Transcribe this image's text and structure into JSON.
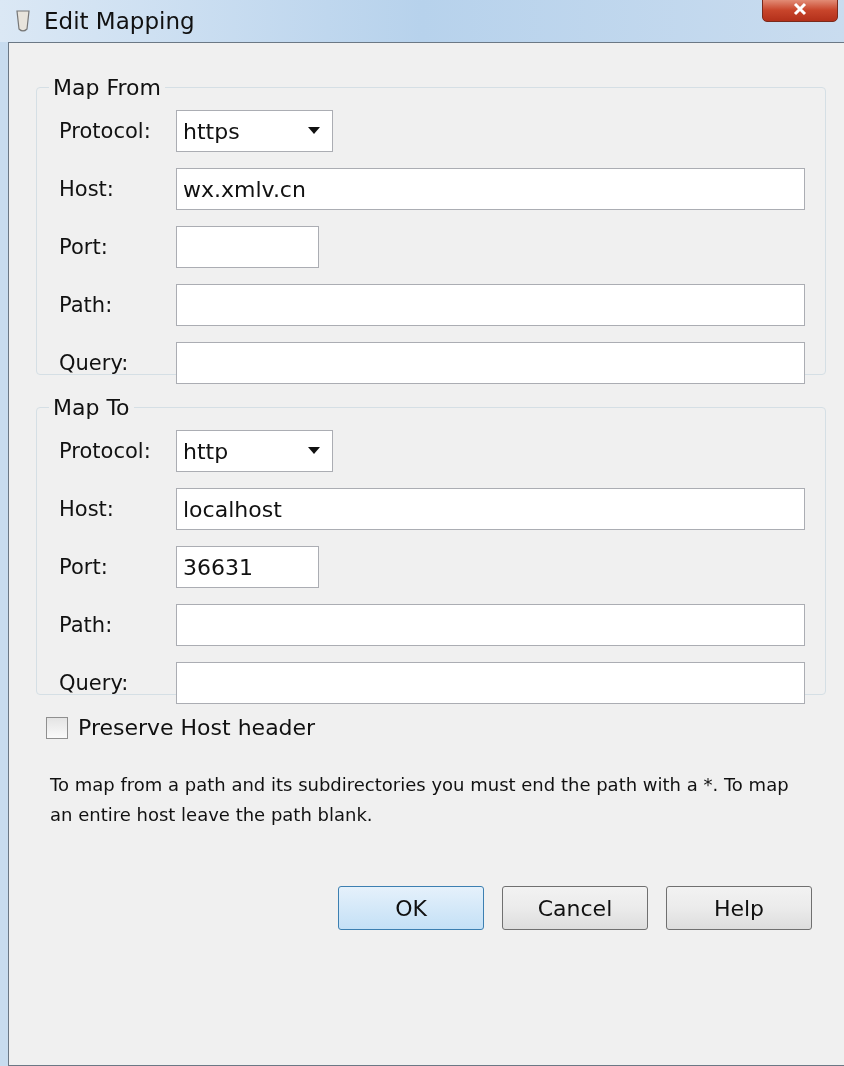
{
  "window": {
    "title": "Edit Mapping"
  },
  "groups": [
    {
      "title": "Map From",
      "fields": [
        {
          "label": "Protocol:",
          "kind": "select",
          "value": "https"
        },
        {
          "label": "Host:",
          "kind": "text",
          "value": "wx.xmlv.cn"
        },
        {
          "label": "Port:",
          "kind": "short"
        },
        {
          "label": "Path:",
          "kind": "text"
        },
        {
          "label": "Query:",
          "kind": "text"
        }
      ]
    },
    {
      "title": "Map To",
      "fields": [
        {
          "label": "Protocol:",
          "kind": "select",
          "value": "http"
        },
        {
          "label": "Host:",
          "kind": "text",
          "value": "localhost"
        },
        {
          "label": "Port:",
          "kind": "short",
          "value": "36631"
        },
        {
          "label": "Path:",
          "kind": "text"
        },
        {
          "label": "Query:",
          "kind": "text"
        }
      ]
    }
  ],
  "preserve_host_header": {
    "label": "Preserve Host header",
    "checked": false
  },
  "note": "To map from a path and its subdirectories you must end the path with a *. To map an entire host leave the path blank.",
  "buttons": [
    {
      "label": "OK",
      "default": true
    },
    {
      "label": "Cancel",
      "default": false
    },
    {
      "label": "Help",
      "default": false
    }
  ]
}
